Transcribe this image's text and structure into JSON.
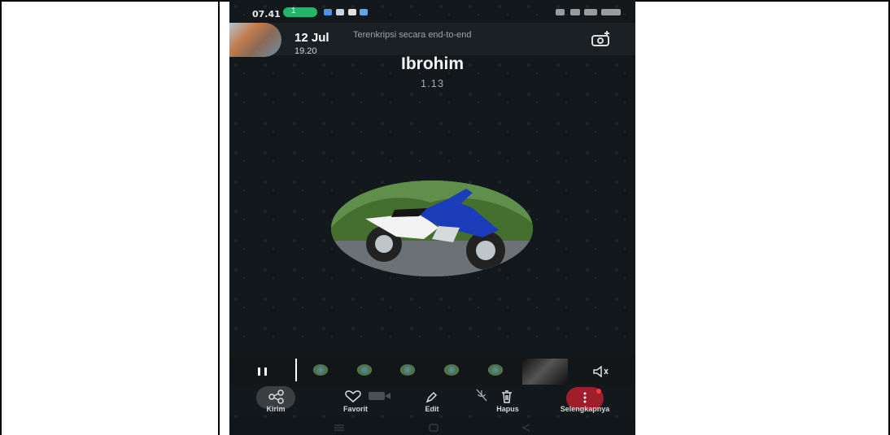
{
  "status_bar": {
    "time": "07.41",
    "notification_count": "1"
  },
  "story_header": {
    "date": "12 Jul",
    "time": "19.20",
    "encryption_notice": "Terenkripsi secara end-to-end"
  },
  "story": {
    "contact_name": "Ibrohim",
    "duration": "1.13"
  },
  "actions": [
    {
      "label": "Kirim",
      "icon": "share-icon"
    },
    {
      "label": "Favorit",
      "icon": "heart-icon"
    },
    {
      "label": "Edit",
      "icon": "pencil-icon"
    },
    {
      "label": "Hapus",
      "icon": "trash-icon"
    },
    {
      "label": "Selengkapnya",
      "icon": "more-icon"
    }
  ],
  "colors": {
    "background": "#12181c",
    "accent": "#23b36b",
    "danger": "#9e1e2c"
  }
}
